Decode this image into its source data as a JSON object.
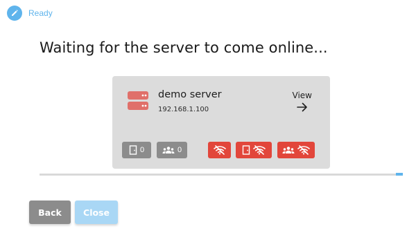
{
  "status": {
    "text": "Ready",
    "icon": "pencil-icon"
  },
  "heading": "Waiting for the server to come online...",
  "server_card": {
    "name": "demo server",
    "ip": "192.168.1.100",
    "view_label": "View",
    "counts": {
      "doors": "0",
      "users": "0"
    }
  },
  "progress": {
    "value_percent": 98
  },
  "buttons": {
    "back_label": "Back",
    "close_label": "Close"
  },
  "colors": {
    "accent": "#5fb4ec",
    "error": "#e2463b",
    "muted": "#8c8c8c",
    "card_bg": "#dcdcdc"
  }
}
